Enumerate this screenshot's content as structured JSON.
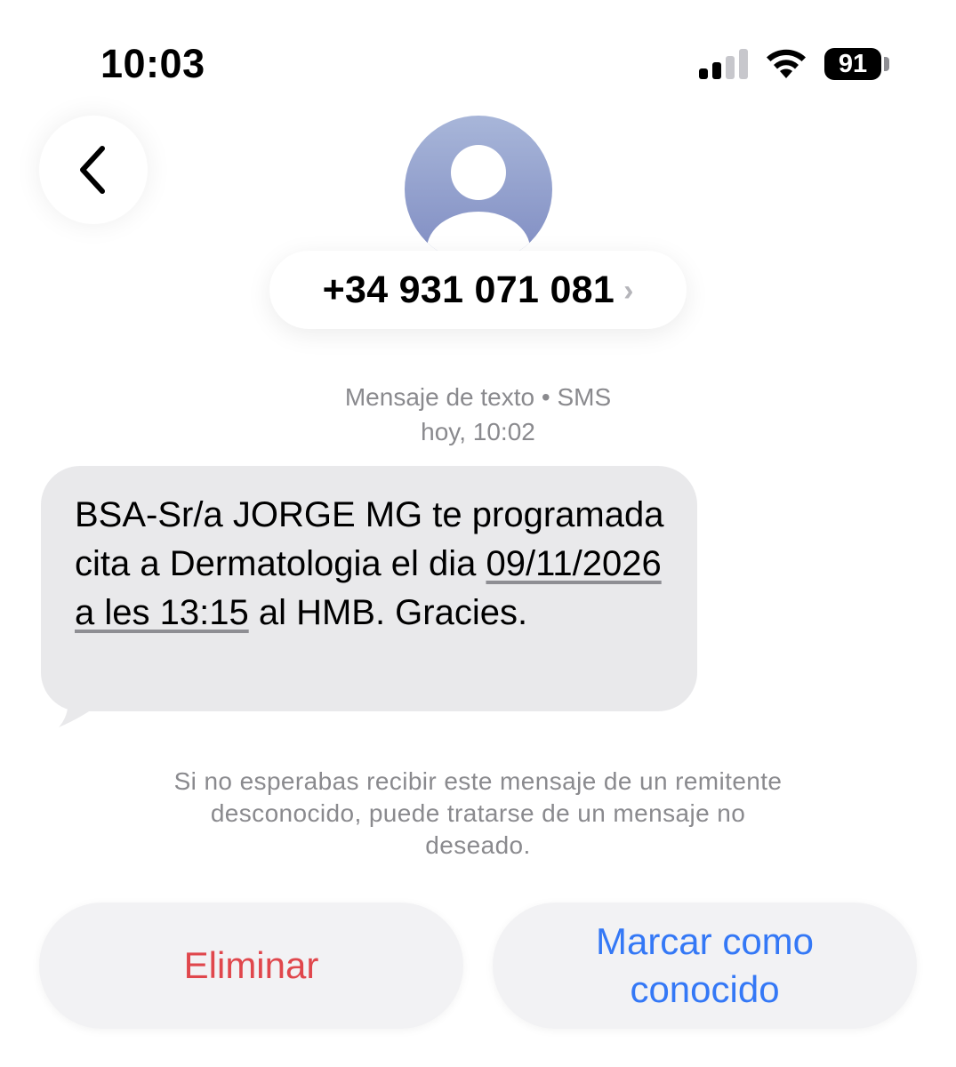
{
  "status_bar": {
    "time": "10:03",
    "battery": "91"
  },
  "header": {
    "contact_number": "+34 931 071 081",
    "chevron": "›"
  },
  "meta": {
    "line1": "Mensaje de texto • SMS",
    "line2": "hoy, 10:02"
  },
  "message": {
    "part1": "BSA-Sr/a JORGE MG te programada cita a Dermatologia el dia ",
    "link_date": "09/11/2026",
    "part2": " ",
    "link_time": "a les 13:15",
    "part3": " al HMB. Gracies."
  },
  "warning": "Si no esperabas recibir este mensaje de un remitente desconocido, puede tratarse de un mensaje no deseado.",
  "actions": {
    "delete_label": "Eliminar",
    "mark_known_label": "Marcar como conocido"
  },
  "colors": {
    "delete": "#e0474c",
    "link_blue": "#3478f6",
    "bubble": "#e9e9eb"
  },
  "icons": {
    "back": "chevron-left-icon",
    "avatar": "person-silhouette-icon",
    "signal": "cellular-signal-icon",
    "wifi": "wifi-icon",
    "battery": "battery-icon"
  }
}
